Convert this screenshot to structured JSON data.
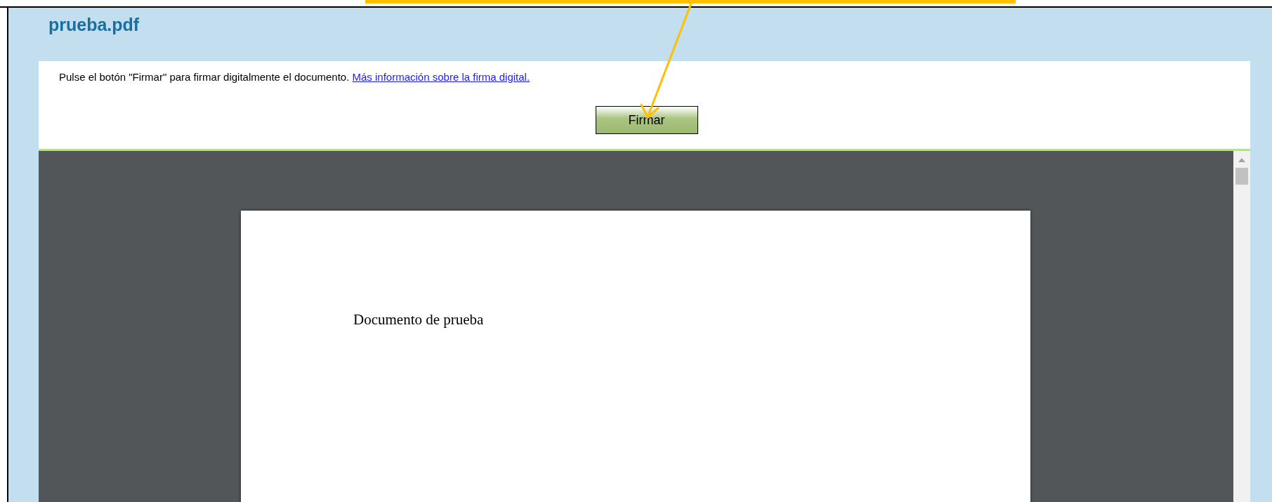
{
  "title": "prueba.pdf",
  "instruction": {
    "text": "Pulse el botón \"Firmar\" para firmar digitalmente el documento.",
    "link": "Más información sobre la firma digital."
  },
  "sign_button": {
    "label": "Firmar"
  },
  "document": {
    "lines": [
      "Documento de prueba"
    ]
  }
}
